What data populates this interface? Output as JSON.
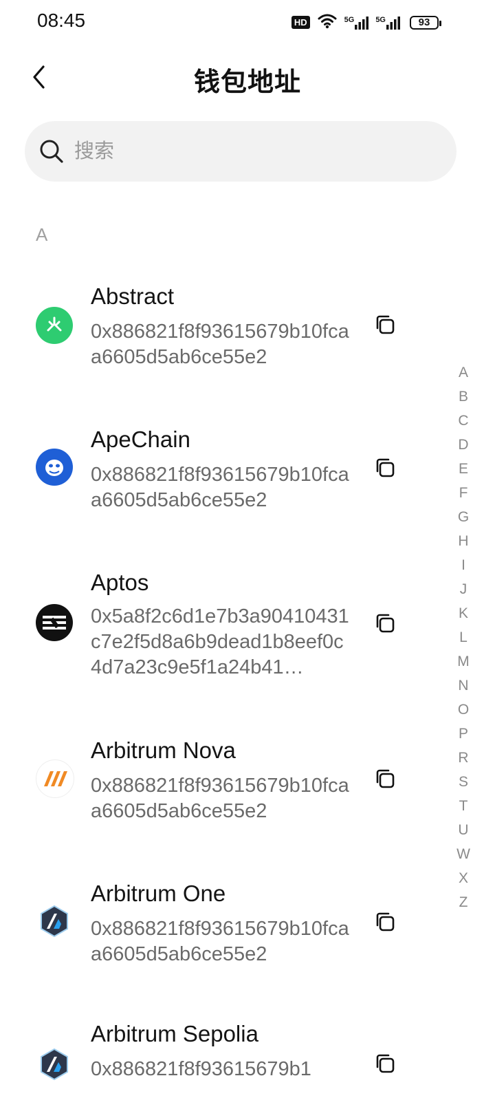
{
  "status": {
    "time": "08:45",
    "hd_label": "HD",
    "signal_1": "5G",
    "signal_2": "5G",
    "battery": "93"
  },
  "header": {
    "back_icon": "chevron-left-icon",
    "title": "钱包地址"
  },
  "search": {
    "placeholder": "搜索",
    "value": "",
    "icon": "search-icon"
  },
  "section": "A",
  "wallets": [
    {
      "name": "Abstract",
      "address": "0x886821f8f93615679b10fcaa6605d5ab6ce55e2",
      "icon_color": "#2ecc71",
      "icon": "abstract-logo-icon"
    },
    {
      "name": "ApeChain",
      "address": "0x886821f8f93615679b10fcaa6605d5ab6ce55e2",
      "icon_color": "#1f5fd6",
      "icon": "apechain-logo-icon"
    },
    {
      "name": "Aptos",
      "address": "0x5a8f2c6d1e7b3a90410431c7e2f5d8a6b9dead1b8eef0c4d7a23c9e5f1a24b41…",
      "icon_color": "#111111",
      "icon": "aptos-logo-icon"
    },
    {
      "name": "Arbitrum Nova",
      "address": "0x886821f8f93615679b10fcaa6605d5ab6ce55e2",
      "icon_color": "#f08a24",
      "icon": "arbitrum-nova-logo-icon"
    },
    {
      "name": "Arbitrum One",
      "address": "0x886821f8f93615679b10fcaa6605d5ab6ce55e2",
      "icon_color": "#2d374b",
      "icon": "arbitrum-one-logo-icon"
    },
    {
      "name": "Arbitrum Sepolia",
      "address": "0x886821f8f93615679b1",
      "icon_color": "#2d374b",
      "icon": "arbitrum-sepolia-logo-icon"
    }
  ],
  "alphabet": [
    "A",
    "B",
    "C",
    "D",
    "E",
    "F",
    "G",
    "H",
    "I",
    "J",
    "K",
    "L",
    "M",
    "N",
    "O",
    "P",
    "R",
    "S",
    "T",
    "U",
    "W",
    "X",
    "Z"
  ],
  "copy_icon": "copy-icon"
}
